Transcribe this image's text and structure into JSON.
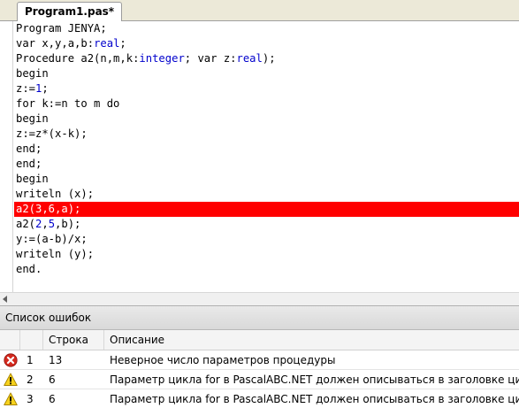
{
  "tab": {
    "title": "Program1.pas*"
  },
  "editor": {
    "lines": [
      [
        {
          "t": "Program JENYA;",
          "c": ""
        }
      ],
      [
        {
          "t": "var x,y,a,b:",
          "c": ""
        },
        {
          "t": "real",
          "c": "kw"
        },
        {
          "t": ";",
          "c": ""
        }
      ],
      [
        {
          "t": "Procedure a2(n,m,k:",
          "c": ""
        },
        {
          "t": "integer",
          "c": "kw"
        },
        {
          "t": "; var z:",
          "c": ""
        },
        {
          "t": "real",
          "c": "kw"
        },
        {
          "t": ");",
          "c": ""
        }
      ],
      [
        {
          "t": "begin",
          "c": ""
        }
      ],
      [
        {
          "t": "z:=",
          "c": ""
        },
        {
          "t": "1",
          "c": "num"
        },
        {
          "t": ";",
          "c": ""
        }
      ],
      [
        {
          "t": "for k:=n to m do",
          "c": ""
        }
      ],
      [
        {
          "t": "begin",
          "c": ""
        }
      ],
      [
        {
          "t": "z:=z*(x-k);",
          "c": ""
        }
      ],
      [
        {
          "t": "end;",
          "c": ""
        }
      ],
      [
        {
          "t": "end;",
          "c": ""
        }
      ],
      [
        {
          "t": "begin",
          "c": ""
        }
      ],
      [
        {
          "t": "writeln (x);",
          "c": ""
        }
      ],
      [
        {
          "t": "a2(3,6,a);",
          "c": ""
        }
      ],
      [
        {
          "t": "a2(",
          "c": ""
        },
        {
          "t": "2",
          "c": "num"
        },
        {
          "t": ",",
          "c": ""
        },
        {
          "t": "5",
          "c": "num"
        },
        {
          "t": ",b);",
          "c": ""
        }
      ],
      [
        {
          "t": "y:=(a-b)/x;",
          "c": ""
        }
      ],
      [
        {
          "t": "writeln (y);",
          "c": ""
        }
      ],
      [
        {
          "t": "end.",
          "c": ""
        }
      ]
    ],
    "error_line_index": 12
  },
  "error_panel": {
    "title": "Список ошибок",
    "headers": {
      "line": "Строка",
      "description": "Описание"
    },
    "rows": [
      {
        "icon": "error-icon",
        "num": "1",
        "line": "13",
        "description": "Неверное число параметров процедуры"
      },
      {
        "icon": "warning-icon",
        "num": "2",
        "line": "6",
        "description": "Параметр цикла for в PascalABC.NET должен описываться в заголовке цикла"
      },
      {
        "icon": "warning-icon",
        "num": "3",
        "line": "6",
        "description": "Параметр цикла for в PascalABC.NET должен описываться в заголовке цикла"
      }
    ]
  },
  "colors": {
    "error_highlight": "#ff0000",
    "keyword": "#0000cc"
  }
}
